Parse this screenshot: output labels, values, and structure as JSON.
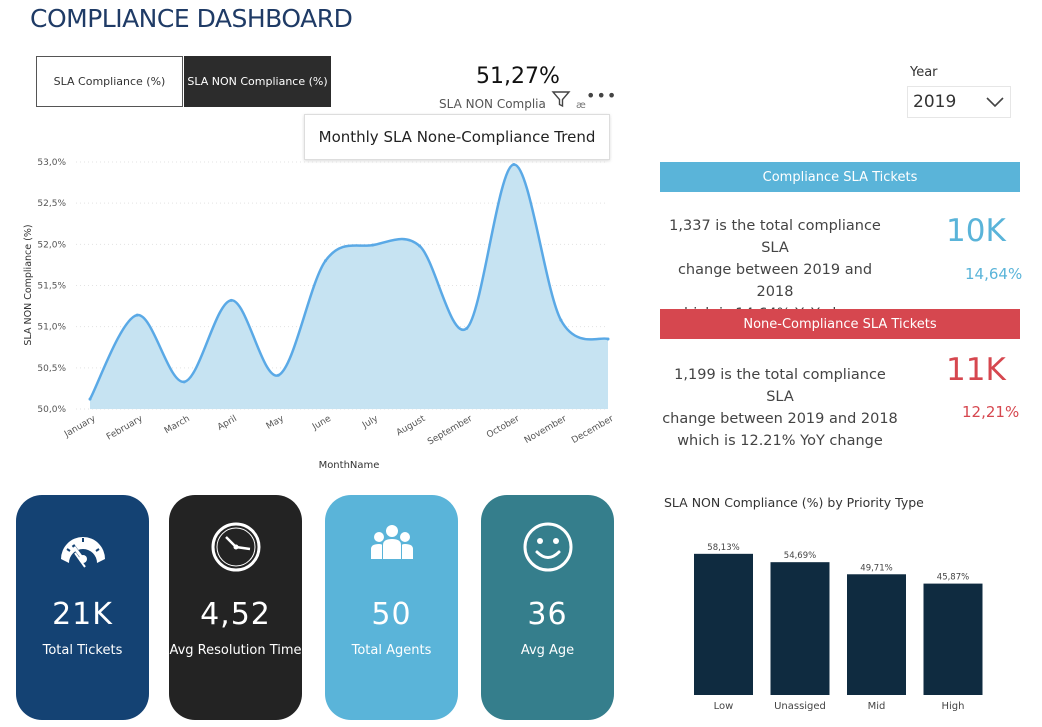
{
  "header": {
    "title": "COMPLIANCE DASHBOARD"
  },
  "toggles": {
    "compliance_label": "SLA Compliance (%)",
    "noncompliance_label": "SLA NON Compliance (%)"
  },
  "kpi": {
    "value": "51,27%",
    "label": "SLA NON Complia",
    "tail": "æ"
  },
  "tooltip": {
    "text": "Monthly SLA None-Compliance Trend"
  },
  "year_filter": {
    "label": "Year",
    "selected": "2019"
  },
  "compliance_section": {
    "banner": "Compliance SLA Tickets",
    "desc_line1": "1,337 is the total compliance SLA",
    "desc_line2": "change between 2019 and 2018",
    "desc_line3": "which is 14.64% YoY change",
    "big_value": "10K",
    "pct": "14,64%",
    "color": "#5ab4d9"
  },
  "noncompliance_section": {
    "banner": "None-Compliance SLA Tickets",
    "desc_line1": "1,199 is the total compliance SLA",
    "desc_line2": "change between 2019 and 2018",
    "desc_line3": "which is 12.21% YoY change",
    "big_value": "11K",
    "pct": "12,21%",
    "color": "#d6474f"
  },
  "cards": {
    "tickets": {
      "value": "21K",
      "label": "Total Tickets",
      "icon": "speedometer-icon"
    },
    "resolution": {
      "value": "4,52",
      "label": "Avg Resolution Time",
      "icon": "clock-icon"
    },
    "agents": {
      "value": "50",
      "label": "Total Agents",
      "icon": "group-icon"
    },
    "age": {
      "value": "36",
      "label": "Avg Age",
      "icon": "smiley-icon"
    }
  },
  "chart_data": [
    {
      "type": "area",
      "xlabel": "MonthName",
      "ylabel": "SLA NON Compliance (%)",
      "ylim": [
        50.0,
        53.0
      ],
      "y_ticks": [
        "50,0%",
        "50,5%",
        "51,0%",
        "51,5%",
        "52,0%",
        "52,5%",
        "53,0%"
      ],
      "grid": true,
      "categories": [
        "January",
        "February",
        "March",
        "April",
        "May",
        "June",
        "July",
        "August",
        "September",
        "October",
        "November",
        "December"
      ],
      "series": [
        {
          "values": [
            50.12,
            51.14,
            50.33,
            51.32,
            50.41,
            51.8,
            51.99,
            51.98,
            50.98,
            52.97,
            51.08,
            50.85
          ],
          "color": "#5aa9e6"
        }
      ]
    },
    {
      "type": "bar",
      "title": "SLA NON Compliance (%) by Priority Type",
      "categories": [
        "Low",
        "Unassiged",
        "Mid",
        "High"
      ],
      "values": [
        58.13,
        54.69,
        49.71,
        45.87
      ],
      "labels": [
        "58,13%",
        "54,69%",
        "49,71%",
        "45,87%"
      ],
      "ylim": [
        0,
        70
      ],
      "color": "#0f2b40"
    }
  ]
}
